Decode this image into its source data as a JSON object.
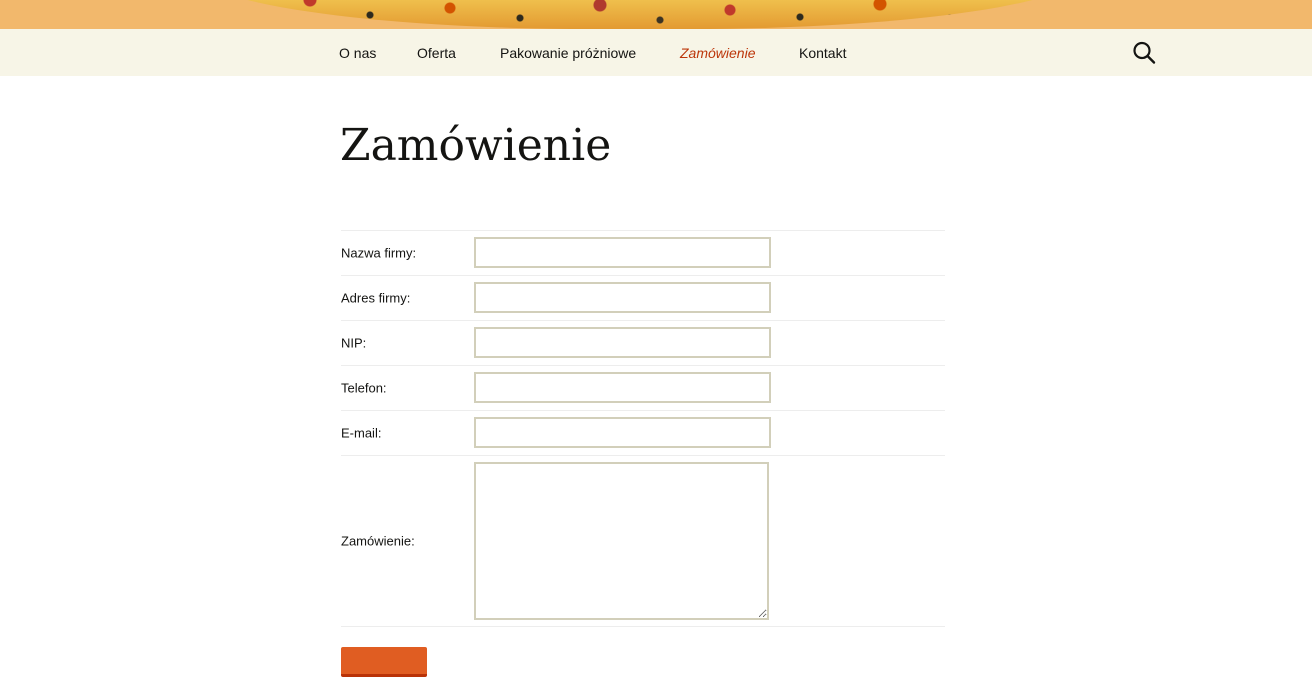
{
  "header": {
    "banner_image": "pizza-photo"
  },
  "nav": {
    "items": [
      {
        "label": "O nas",
        "current": false
      },
      {
        "label": "Oferta",
        "current": false
      },
      {
        "label": "Pakowanie próżniowe",
        "current": false
      },
      {
        "label": "Zamówienie",
        "current": true
      },
      {
        "label": "Kontakt",
        "current": false
      }
    ],
    "search_icon": "search-icon"
  },
  "page": {
    "title": "Zamówienie"
  },
  "form": {
    "fields": [
      {
        "label": "Nazwa firmy:",
        "value": ""
      },
      {
        "label": "Adres firmy:",
        "value": ""
      },
      {
        "label": "NIP:",
        "value": ""
      },
      {
        "label": "Telefon:",
        "value": ""
      },
      {
        "label": "E-mail:",
        "value": ""
      },
      {
        "label": "Zamówienie:",
        "value": ""
      }
    ],
    "submit_label": ""
  },
  "colors": {
    "accent": "#bc360a",
    "navbar_bg": "#f7f5e7",
    "banner_bg": "#f2b86c",
    "input_border": "#d2cfba",
    "button_bg": "#e05d22"
  }
}
